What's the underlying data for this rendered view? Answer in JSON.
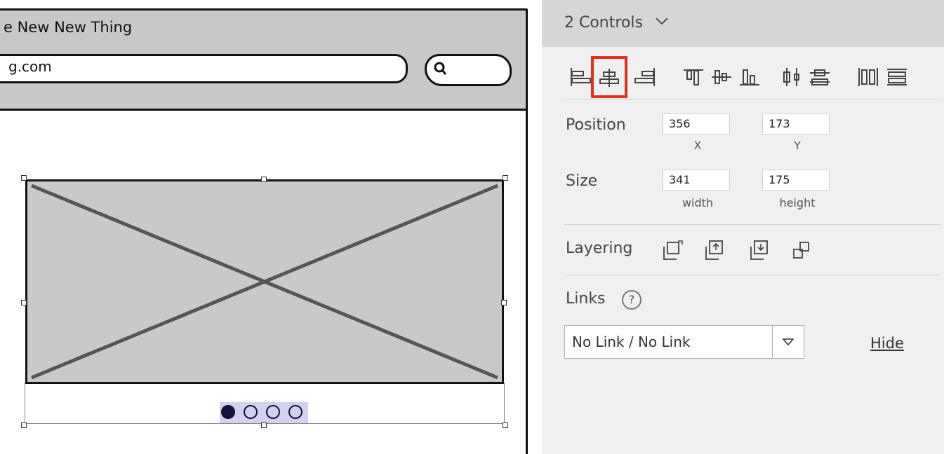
{
  "canvas": {
    "window_title": "e New New Thing",
    "url": "g.com",
    "carousel": {
      "total": 4,
      "active": 1
    }
  },
  "panel": {
    "header": {
      "title": "2 Controls"
    },
    "alignment": {
      "icons": [
        "align-left-icon",
        "align-center-icon",
        "align-right-icon",
        "align-top-icon",
        "align-middle-icon",
        "align-bottom-icon",
        "distribute-horizontal-icon",
        "distribute-vertical-icon",
        "space-horizontal-icon",
        "space-vertical-icon"
      ],
      "selected": "align-center-icon",
      "selected_color": "#e0301e"
    },
    "position": {
      "label": "Position",
      "x": "356",
      "y": "173",
      "x_caption": "X",
      "y_caption": "Y"
    },
    "size": {
      "label": "Size",
      "width": "341",
      "height": "175",
      "width_caption": "width",
      "height_caption": "height"
    },
    "layering": {
      "label": "Layering",
      "icons": [
        "bring-to-front-icon",
        "bring-forward-icon",
        "send-backward-icon",
        "send-to-back-icon"
      ]
    },
    "links": {
      "label": "Links",
      "help": "?",
      "select_value": "No Link / No Link",
      "hide_label": "Hide"
    }
  }
}
